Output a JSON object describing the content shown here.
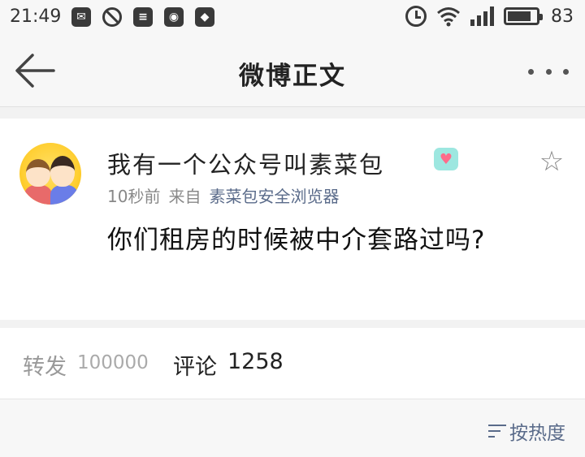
{
  "status_bar": {
    "time": "21:49",
    "battery": "83",
    "battery_level": 0.83,
    "left_icons": [
      "wechat-icon",
      "block-icon",
      "news-icon",
      "weibo-icon",
      "shield-icon"
    ],
    "right_icons": [
      "alarm-icon",
      "wifi-icon",
      "signal-icon",
      "battery-icon"
    ]
  },
  "header": {
    "title": "微博正文"
  },
  "post": {
    "username": "我有一个公众号叫素菜包",
    "badge": "♥",
    "time_ago": "10秒前",
    "from_label": "来自",
    "source": "素菜包安全浏览器",
    "text": "你们租房的时候被中介套路过吗?",
    "star": "☆"
  },
  "stats": {
    "repost_label": "转发",
    "repost_count": "100000",
    "comment_label": "评论",
    "comment_count": "1258"
  },
  "sort": {
    "label": "按热度"
  },
  "colors": {
    "background": "#f2f2f2",
    "card": "#ffffff",
    "link": "#5a6b8a",
    "muted": "#888888"
  }
}
